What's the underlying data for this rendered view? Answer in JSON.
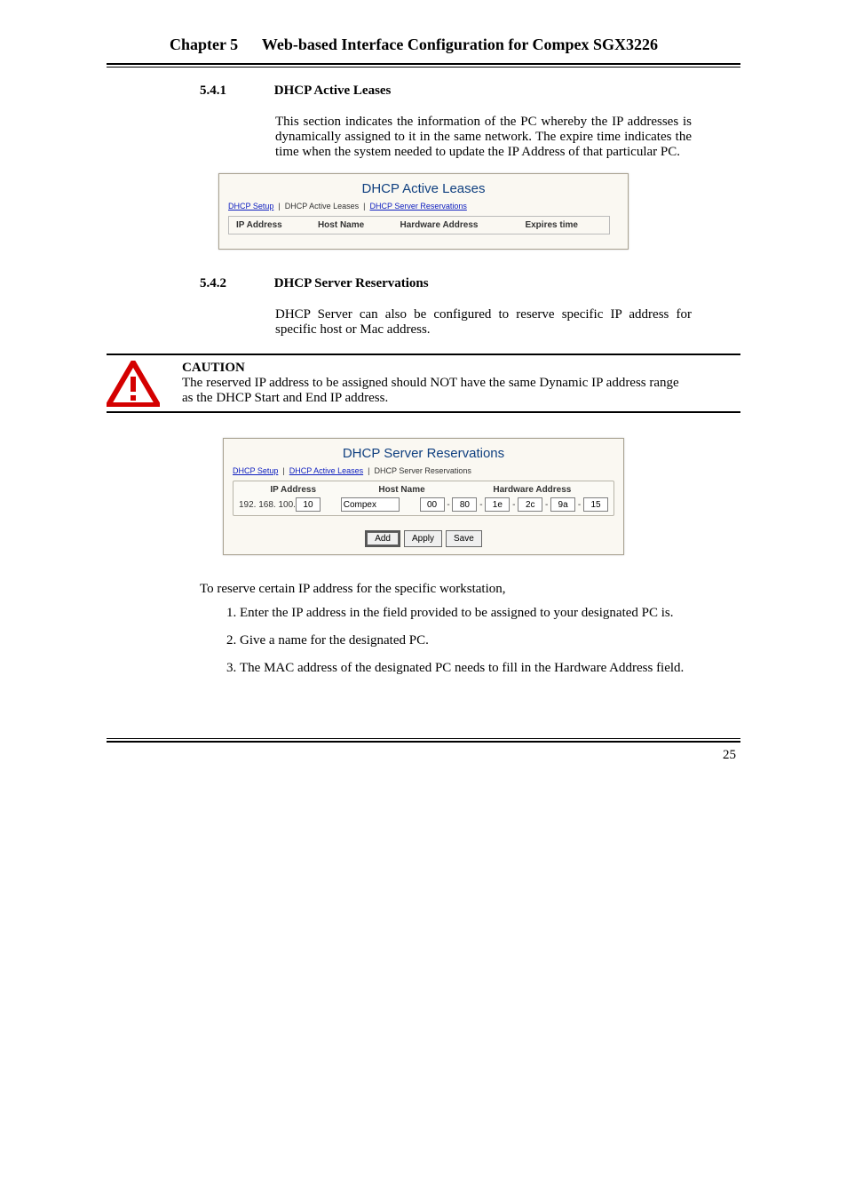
{
  "header": {
    "chapter": "Chapter 5",
    "title": "Web-based Interface Configuration for Compex SGX3226"
  },
  "section_541": {
    "number": "5.4.1",
    "title": "DHCP Active Leases",
    "body": "This section indicates the information of the PC whereby the IP addresses is dynamically assigned to it in the same network. The expire time indicates the time when the system needed to update the IP Address of that particular PC."
  },
  "leases_panel": {
    "title": "DHCP Active Leases",
    "tabs": [
      "DHCP Setup",
      "DHCP Active Leases",
      "DHCP Server Reservations"
    ],
    "active_tab_index": 1,
    "columns": [
      "IP Address",
      "Host Name",
      "Hardware Address",
      "Expires time"
    ]
  },
  "section_542": {
    "number": "5.4.2",
    "title": "DHCP Server Reservations",
    "body": "DHCP Server can also be configured to reserve specific IP address for specific host or Mac address."
  },
  "caution": {
    "heading": "CAUTION",
    "text": "The reserved IP address to be assigned should NOT have the same Dynamic IP address range as the DHCP Start and End IP address."
  },
  "res_panel": {
    "title": "DHCP Server Reservations",
    "tabs": [
      "DHCP Setup",
      "DHCP Active Leases",
      "DHCP Server Reservations"
    ],
    "active_tab_index": 2,
    "columns": [
      "IP Address",
      "Host Name",
      "Hardware Address"
    ],
    "ip_prefix": "192. 168. 100.",
    "ip_last": "10",
    "host": "Compex",
    "mac": [
      "00",
      "80",
      "1e",
      "2c",
      "9a",
      "15"
    ],
    "buttons": [
      "Add",
      "Apply",
      "Save"
    ]
  },
  "reserve_intro": "To reserve certain IP address for the specific workstation,",
  "steps": [
    "Enter the IP address in the field provided to be assigned to your designated PC is.",
    "Give a name for the designated PC.",
    "The MAC address of the designated PC needs to fill in the Hardware Address field."
  ],
  "page_number": "25"
}
